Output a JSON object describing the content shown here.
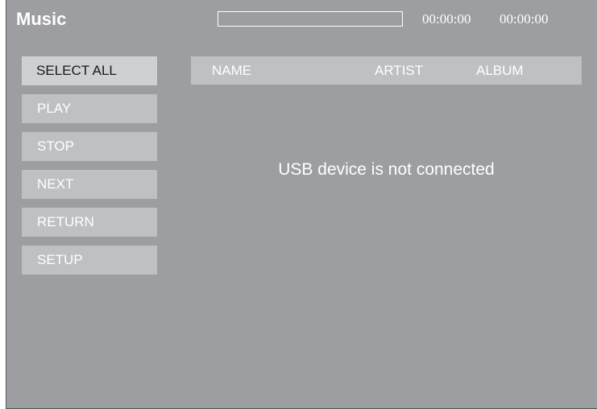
{
  "header": {
    "title": "Music",
    "progress": 0,
    "elapsed_time": "00:00:00",
    "total_time": "00:00:00"
  },
  "menu": {
    "items": [
      {
        "label": "SELECT ALL",
        "selected": true
      },
      {
        "label": "PLAY",
        "selected": false
      },
      {
        "label": "STOP",
        "selected": false
      },
      {
        "label": "NEXT",
        "selected": false
      },
      {
        "label": "RETURN",
        "selected": false
      },
      {
        "label": "SETUP",
        "selected": false
      }
    ]
  },
  "list": {
    "columns": [
      "NAME",
      "ARTIST",
      "ALBUM"
    ],
    "rows": []
  },
  "status_message": "USB device is not connected",
  "colors": {
    "background": "#9d9ea2",
    "button": "#bfc0c3",
    "button_selected": "#cfd0d3",
    "text": "#ffffff"
  }
}
